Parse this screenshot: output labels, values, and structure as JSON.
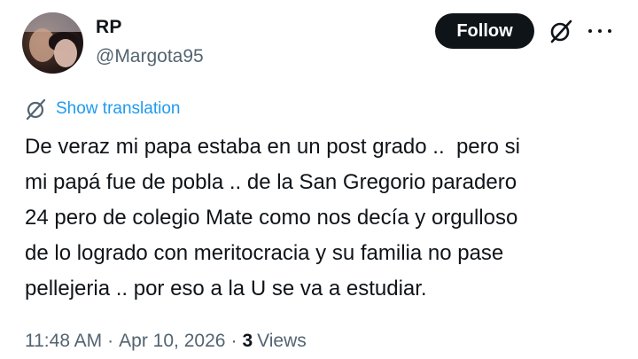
{
  "author": {
    "display_name": "RP",
    "handle": "@Margota95"
  },
  "actions": {
    "follow_label": "Follow",
    "grok_icon": "grok-icon",
    "more_icon": "more-icon"
  },
  "translate": {
    "label": "Show translation",
    "icon": "translate-icon"
  },
  "tweet": {
    "lines": [
      "De veraz mi papa estaba en un post grado ..  pero si",
      "mi papá fue de pobla .. de la San Gregorio paradero",
      "24 pero de colegio Mate como nos decía y orgulloso",
      "de lo logrado con meritocracia y su familia no pase",
      "pellejeria .. por eso a la U se va a estudiar."
    ]
  },
  "meta": {
    "time": "11:48 AM",
    "separator": "·",
    "date": "Apr 10, 2026",
    "views_count": "3",
    "views_label": "Views"
  },
  "colors": {
    "text": "#0f1419",
    "secondary": "#536471",
    "link": "#1d9bf0",
    "button_bg": "#0f1419"
  }
}
